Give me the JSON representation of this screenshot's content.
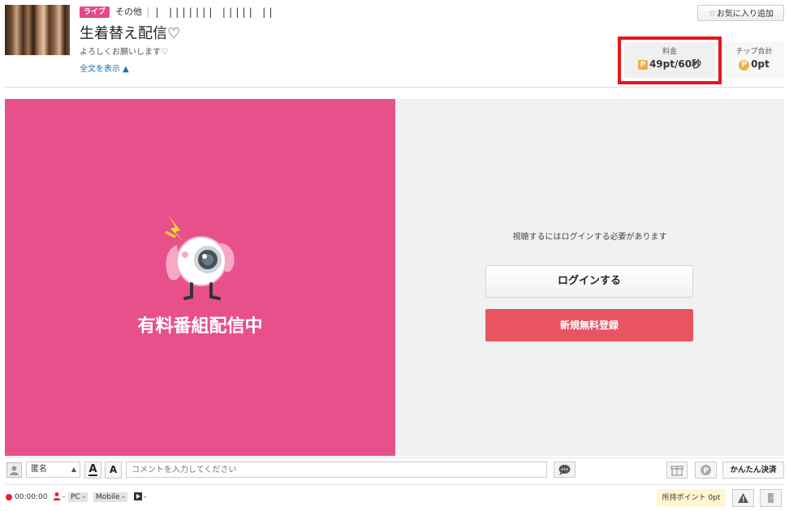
{
  "header": {
    "badge": "ライブ",
    "category": "その他",
    "user_name": "| ||||||| ||||| ||",
    "title": "生着替え配信♡",
    "description": "よろしくお願いします♡",
    "show_full": "全文を表示 ▲",
    "favorite_button": "お気に入り追加"
  },
  "stats": {
    "price_label": "料金",
    "price_value": "49pt/60秒",
    "tip_label": "チップ合計",
    "tip_value": "0pt",
    "coin_symbol": "P"
  },
  "player": {
    "status_text": "有料番組配信中",
    "login_message": "視聴するにはログインする必要があります",
    "login_button": "ログインする",
    "register_button": "新規無料登録"
  },
  "comment_bar": {
    "name_value": "匿名",
    "font_button": "A",
    "size_button": "A",
    "comment_placeholder": "コメントを入力してください",
    "easy_pay_button": "かんたん決済"
  },
  "status_bar": {
    "time": "00:00:00",
    "viewers": "-",
    "pc_chip": "PC -",
    "mobile_chip": "Mobile -",
    "play_count": "-",
    "points_label": "所持ポイント 0pt"
  },
  "colors": {
    "pink": "#e8508b",
    "register_red": "#e85462",
    "highlight_red": "#e8141b",
    "coin": "#f0b13b"
  }
}
